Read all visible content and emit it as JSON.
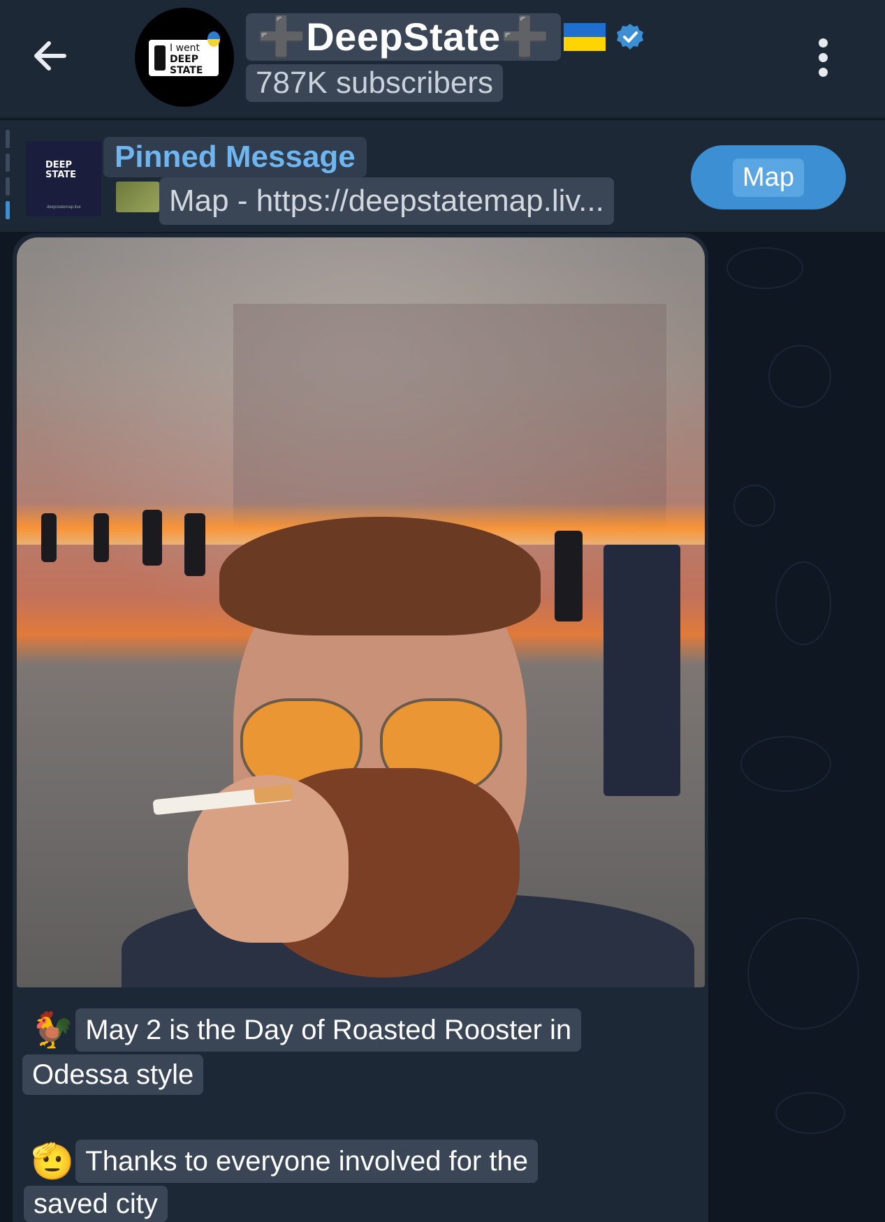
{
  "header": {
    "back_icon": "arrow-left-icon",
    "channel_title": "➕DeepState➕",
    "subscribers": "787K subscribers",
    "avatar_text_line1": "I went",
    "avatar_text_line2": "DEEP STATE",
    "menu_icon": "more-vertical-icon"
  },
  "pinned": {
    "title": "Pinned Message",
    "preview": "Map - https://deepstatemap.liv...",
    "thumb_logo": "DEEP STATE",
    "thumb_url": "deepstatemap.live",
    "button_label": "Map"
  },
  "message": {
    "line1_emoji": "🐓",
    "line1_a": "May 2 is the Day of Roasted Rooster in",
    "line1_b": "Odessa style",
    "line2_emoji": "🫡",
    "line2_a": "Thanks to everyone involved for the",
    "line2_b": "saved city"
  },
  "colors": {
    "accent": "#3d8fd4",
    "link": "#6fb5ef",
    "header_bg": "#1d2836",
    "chat_bg": "#0f1722"
  }
}
